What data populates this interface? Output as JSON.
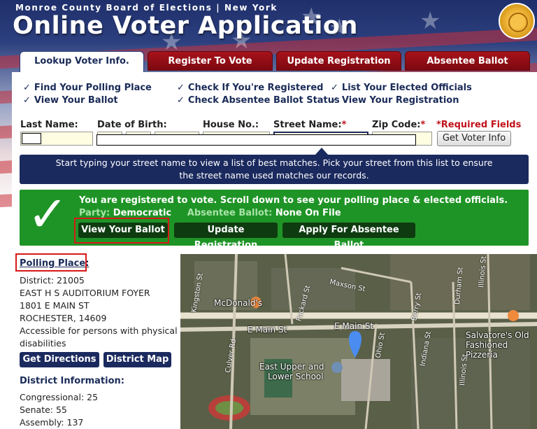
{
  "header": {
    "county": "Monroe County Board of Elections | New York",
    "title": "Online Voter Application"
  },
  "tabs": [
    {
      "label": "Lookup Voter Info."
    },
    {
      "label": "Register To Vote"
    },
    {
      "label": "Update Registration"
    },
    {
      "label": "Absentee Ballot"
    }
  ],
  "quick_links": [
    {
      "label": "Find Your Polling Place"
    },
    {
      "label": "View Your Ballot"
    },
    {
      "label": "Check If You're Registered"
    },
    {
      "label": "Check Absentee Ballot Status"
    },
    {
      "label": "List Your Elected Officials"
    },
    {
      "label": "View Your Registration"
    }
  ],
  "lookup_form": {
    "last_name_label": "Last Name:",
    "dob_label": "Date of Birth:",
    "house_label": "House No.:",
    "street_label": "Street Name:",
    "zip_label": "Zip Code:",
    "required_marker": "*",
    "required_note": "*Required Fields",
    "submit_label": "Get Voter Info"
  },
  "hint": {
    "line1": "Start typing your street name to view a list of best matches. Pick your street from this list to ensure",
    "line2": "the street name used matches our records."
  },
  "status": {
    "message": "You are registered to vote. Scroll down to see your polling place & elected officials.",
    "party_label": "Party:",
    "party_value": "Democratic",
    "absentee_label": "Absentee Ballot:",
    "absentee_value": "None On File",
    "buttons": {
      "view_ballot": "View Your Ballot",
      "update_registration": "Update Registration",
      "absentee": "Apply For Absentee Ballot"
    }
  },
  "polling_place": {
    "title": "Polling Place:",
    "district": "District: 21005",
    "name": "EAST H S AUDITORIUM FOYER",
    "street": "1801 E MAIN ST",
    "city": "ROCHESTER, 14609",
    "accessibility_1": "Accessible for persons with physical",
    "accessibility_2": "disabilities",
    "directions_label": "Get Directions",
    "map_label": "District Map"
  },
  "district_info": {
    "title": "District Information:",
    "congressional": "Congressional: 25",
    "senate": "Senate: 55",
    "assembly": "Assembly: 137"
  },
  "map": {
    "labels": {
      "mcdonalds": "McDonald's",
      "maxson": "Maxson St",
      "emain1": "E Main St",
      "emain2": "E Main St",
      "school1": "East Upper and",
      "school2": "Lower School",
      "salvatore1": "Salvatore's Old",
      "salvatore2": "Fashioned Pizzeria",
      "kingston": "Kingston St",
      "packard": "Packard St",
      "culver": "Culver Rd",
      "ohio": "Ohio St",
      "berry": "Berry St",
      "indiana": "Indiana St",
      "durham": "Durham St",
      "illinois": "Illinois St"
    }
  },
  "colors": {
    "navy": "#1b2a5e",
    "tab_red": "#8e0c14",
    "success_green": "#1f9426",
    "highlight_red": "#d81818"
  }
}
